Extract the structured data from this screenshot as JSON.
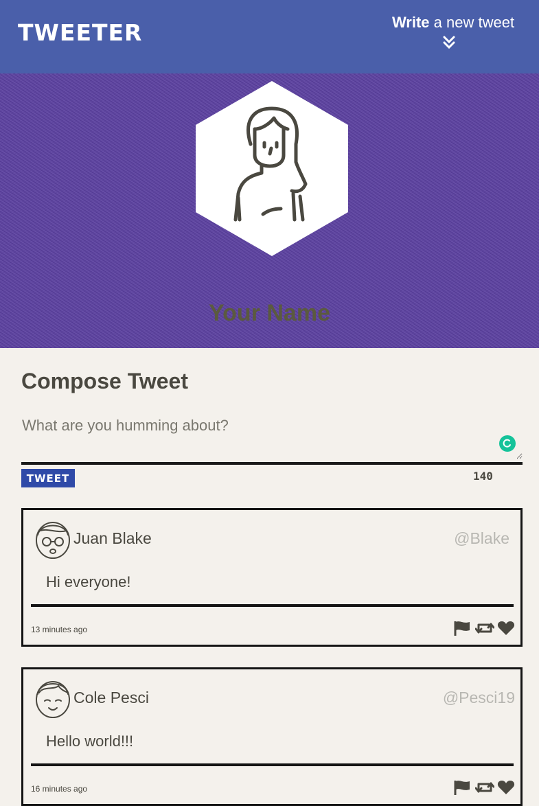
{
  "nav": {
    "brand": "TWEETER",
    "compose_toggle_bold": "Write",
    "compose_toggle_rest": " a new tweet"
  },
  "hero": {
    "name": "Your Name"
  },
  "compose": {
    "title": "Compose Tweet",
    "placeholder": "What are you humming about?",
    "button_label": "TWEET",
    "char_counter": "140"
  },
  "tweets": [
    {
      "name": "Juan Blake",
      "handle": "@Blake",
      "body": "Hi everyone!",
      "time": "13 minutes ago",
      "avatar_icon": "glasses-avatar-icon"
    },
    {
      "name": "Cole Pesci",
      "handle": "@Pesci19",
      "body": "Hello world!!!",
      "time": "16 minutes ago",
      "avatar_icon": "smile-avatar-icon"
    }
  ],
  "colors": {
    "nav": "#4a5faa",
    "hero": "#5a3f9f",
    "tweet_button": "#2f4aa8",
    "background": "#f4f1ec"
  }
}
